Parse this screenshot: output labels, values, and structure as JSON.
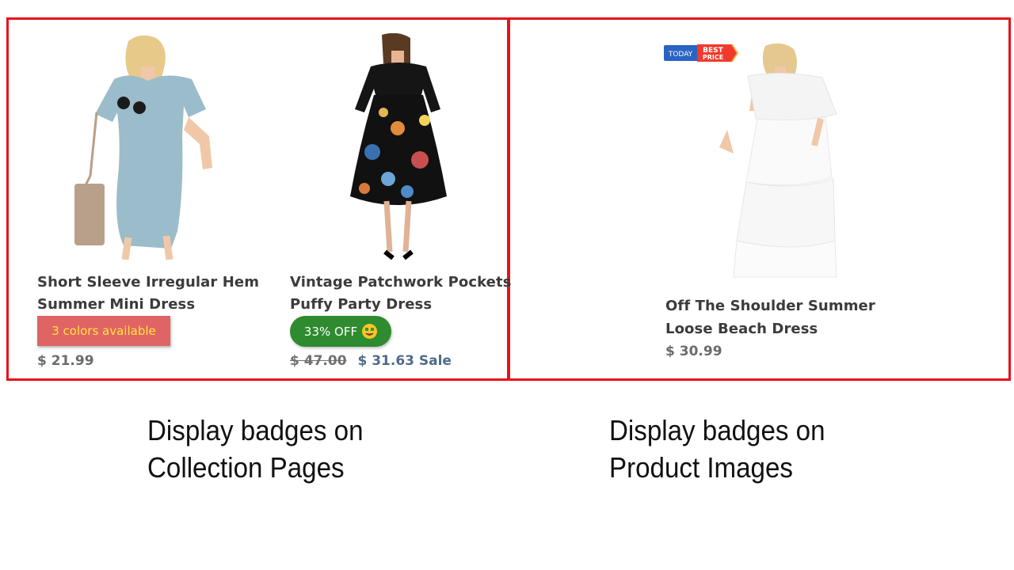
{
  "collection": {
    "products": [
      {
        "title_line1": "Short Sleeve Irregular Hem",
        "title_line2": "Summer Mini Dress",
        "badge": "3 colors available",
        "price": "$ 21.99"
      },
      {
        "title_line1": "Vintage Patchwork Pockets",
        "title_line2": "Puffy Party Dress",
        "badge": "33% OFF",
        "compare_price": "$ 47.00",
        "sale_price": "$ 31.63 Sale"
      }
    ],
    "caption_line1": "Display badges on",
    "caption_line2": "Collection Pages"
  },
  "product_page": {
    "badge_today": "TODAY",
    "badge_best": "BEST",
    "badge_price": "PRICE",
    "title_line1": "Off The Shoulder Summer",
    "title_line2": "Loose Beach Dress",
    "price": "$ 30.99",
    "caption_line1": "Display badges on",
    "caption_line2": "Product Images"
  },
  "colors": {
    "frame_border": "#e8121b",
    "badge_colors_bg": "#e06464",
    "badge_colors_text": "#ffe63a",
    "badge_off_bg": "#2e8b2f",
    "sale_price": "#4f6b8a"
  }
}
